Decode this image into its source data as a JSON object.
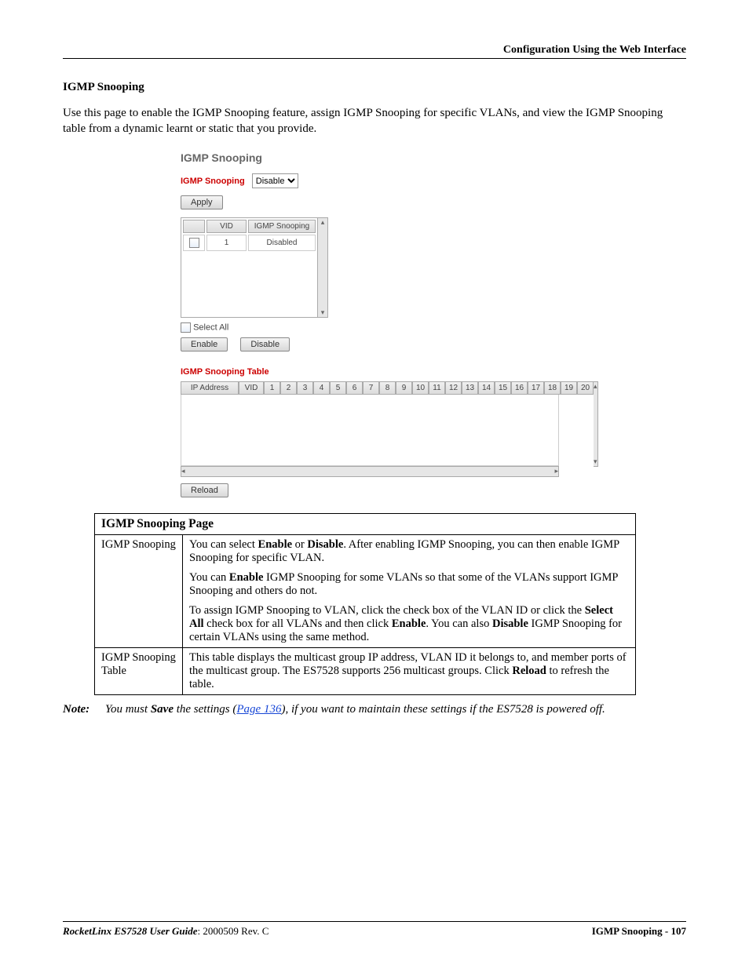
{
  "header": {
    "right": "Configuration Using the Web Interface"
  },
  "heading": "IGMP Snooping",
  "intro": "Use this page to enable the IGMP Snooping feature, assign IGMP Snooping for specific VLANs, and view the IGMP Snooping table from a dynamic learnt or static that you provide.",
  "shot": {
    "app_title": "IGMP Snooping",
    "panel_label": "IGMP Snooping",
    "dropdown_value": "Disable",
    "apply_label": "Apply",
    "vid_header": "VID",
    "snoop_header": "IGMP Snooping",
    "row_vid": "1",
    "row_state": "Disabled",
    "select_all_label": "Select All",
    "enable_label": "Enable",
    "disable_label": "Disable",
    "table_panel_label": "IGMP Snooping Table",
    "ip_header": "IP Address",
    "vid2_header": "VID",
    "ports": [
      "1",
      "2",
      "3",
      "4",
      "5",
      "6",
      "7",
      "8",
      "9",
      "10",
      "11",
      "12",
      "13",
      "14",
      "15",
      "16",
      "17",
      "18",
      "19",
      "20"
    ],
    "reload_label": "Reload"
  },
  "desc": {
    "title": "IGMP Snooping Page",
    "row1_label": "IGMP Snooping",
    "row1a_pre": "You can select ",
    "row1a_b1": "Enable",
    "row1a_mid": " or ",
    "row1a_b2": "Disable",
    "row1a_post": ". After enabling IGMP Snooping, you can then enable IGMP Snooping for specific VLAN.",
    "row1b_pre": "You can ",
    "row1b_b": "Enable",
    "row1b_post": " IGMP Snooping for some VLANs so that some of the VLANs support IGMP Snooping and others do not.",
    "row1c_pre": "To assign IGMP Snooping to VLAN, click the check box of the VLAN ID or click the ",
    "row1c_b1": "Select All",
    "row1c_mid1": " check box for all VLANs and then click ",
    "row1c_b2": "Enable",
    "row1c_mid2": ". You can also ",
    "row1c_b3": "Disable",
    "row1c_post": " IGMP Snooping for certain VLANs using the same method.",
    "row2_label": "IGMP Snooping Table",
    "row2_pre": "This table displays the multicast group IP address, VLAN ID it belongs to, and member ports of the multicast group. The ES7528 supports 256 multicast groups. Click ",
    "row2_b": "Reload",
    "row2_post": " to refresh the table."
  },
  "note": {
    "label": "Note:",
    "pre": "You must ",
    "b": "Save",
    "mid": " the settings (",
    "link": "Page 136",
    "post": "), if you want to maintain these settings if the ES7528 is powered off."
  },
  "footer": {
    "left_it": "RocketLinx ES7528  User Guide",
    "left_rest": ": 2000509 Rev. C",
    "right": "IGMP Snooping - 107"
  }
}
